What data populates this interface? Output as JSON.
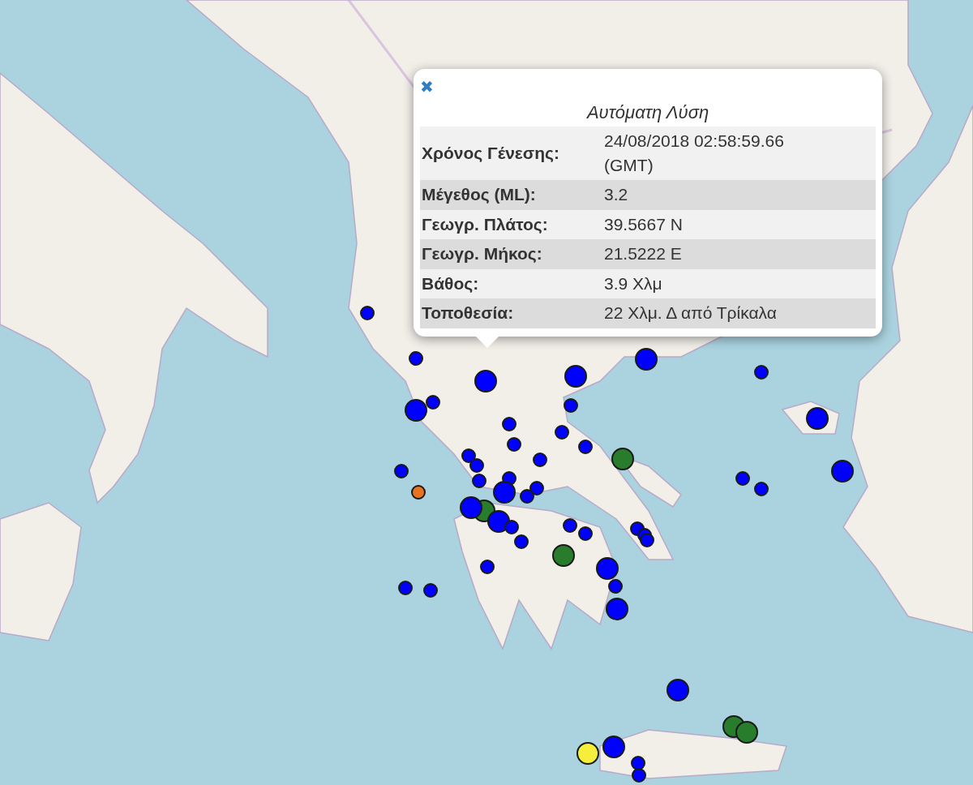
{
  "markers": [
    {
      "color": "#0000ff",
      "kind": "small"
    },
    {
      "color": "#0000ff",
      "kind": "small"
    },
    {
      "color": "#0000ff",
      "kind": "large"
    },
    {
      "color": "#0000ff",
      "kind": "large"
    },
    {
      "color": "#0000ff",
      "kind": "large"
    },
    {
      "color": "#0000ff",
      "kind": "small"
    },
    {
      "color": "#0000ff",
      "kind": "small"
    },
    {
      "color": "#0000ff",
      "kind": "large"
    },
    {
      "color": "#0000ff",
      "kind": "small"
    },
    {
      "color": "#0000ff",
      "kind": "small"
    },
    {
      "color": "#0000ff",
      "kind": "small"
    },
    {
      "color": "#0000ff",
      "kind": "small"
    },
    {
      "color": "#0000ff",
      "kind": "small"
    },
    {
      "color": "#287d2d",
      "kind": "large"
    },
    {
      "color": "#0000ff",
      "kind": "small"
    },
    {
      "color": "#0000ff",
      "kind": "small"
    },
    {
      "color": "#0000ff",
      "kind": "small"
    },
    {
      "color": "#0000ff",
      "kind": "small"
    },
    {
      "color": "#0000ff",
      "kind": "large"
    },
    {
      "color": "#0000ff",
      "kind": "large"
    },
    {
      "color": "#0000ff",
      "kind": "small"
    },
    {
      "color": "#0000ff",
      "kind": "small"
    },
    {
      "color": "#0000ff",
      "kind": "small"
    },
    {
      "color": "#0000ff",
      "kind": "small"
    },
    {
      "color": "#e8731f",
      "kind": "small"
    },
    {
      "color": "#0000ff",
      "kind": "small"
    },
    {
      "color": "#0000ff",
      "kind": "small"
    },
    {
      "color": "#0000ff",
      "kind": "large"
    },
    {
      "color": "#287d2d",
      "kind": "large"
    },
    {
      "color": "#0000ff",
      "kind": "large"
    },
    {
      "color": "#0000ff",
      "kind": "large"
    },
    {
      "color": "#0000ff",
      "kind": "small"
    },
    {
      "color": "#0000ff",
      "kind": "small"
    },
    {
      "color": "#0000ff",
      "kind": "small"
    },
    {
      "color": "#0000ff",
      "kind": "small"
    },
    {
      "color": "#0000ff",
      "kind": "small"
    },
    {
      "color": "#0000ff",
      "kind": "small"
    },
    {
      "color": "#0000ff",
      "kind": "small"
    },
    {
      "color": "#287d2d",
      "kind": "large"
    },
    {
      "color": "#0000ff",
      "kind": "large"
    },
    {
      "color": "#0000ff",
      "kind": "small"
    },
    {
      "color": "#0000ff",
      "kind": "small"
    },
    {
      "color": "#0000ff",
      "kind": "large"
    },
    {
      "color": "#0000ff",
      "kind": "small"
    },
    {
      "color": "#0000ff",
      "kind": "small"
    },
    {
      "color": "#0000ff",
      "kind": "large"
    },
    {
      "color": "#287d2d",
      "kind": "large"
    },
    {
      "color": "#287d2d",
      "kind": "large"
    },
    {
      "color": "#0000ff",
      "kind": "large"
    },
    {
      "color": "#f5ef3c",
      "kind": "large"
    },
    {
      "color": "#0000ff",
      "kind": "small"
    },
    {
      "color": "#0000ff",
      "kind": "small"
    }
  ],
  "popup": {
    "close": "✖",
    "title": "Αυτόματη Λύση",
    "rows": [
      {
        "label": "Χρόνος Γένεσης:",
        "value": "24/08/2018 02:58:59.66 (GMT)"
      },
      {
        "label": "Μέγεθος (ML):",
        "value": "3.2"
      },
      {
        "label": "Γεωγρ. Πλάτος:",
        "value": "39.5667 N"
      },
      {
        "label": "Γεωγρ. Μήκος:",
        "value": "21.5222 E"
      },
      {
        "label": "Βάθος:",
        "value": "3.9 Χλμ"
      },
      {
        "label": "Τοποθεσία:",
        "value": "22 Χλμ. Δ από Τρίκαλα"
      }
    ]
  }
}
